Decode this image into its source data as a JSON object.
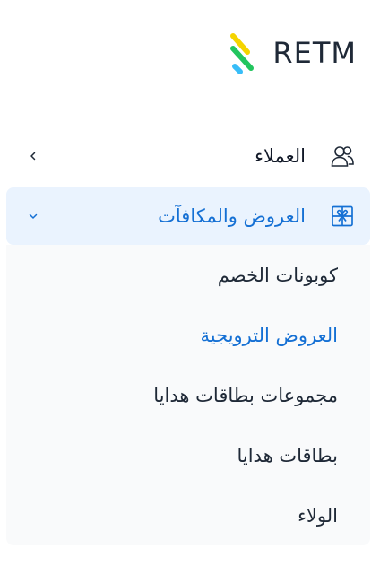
{
  "brand": {
    "name": "RETM",
    "icon": "logo-stripes-icon",
    "colors": [
      "#f5d400",
      "#22c55e",
      "#38bdf8"
    ]
  },
  "sidebar": {
    "items": [
      {
        "label": "العملاء",
        "icon": "users-icon",
        "chevron": "chevron-left-icon",
        "expanded": false
      },
      {
        "label": "العروض والمكافآت",
        "icon": "gift-icon",
        "chevron": "chevron-down-icon",
        "expanded": true,
        "active": true,
        "children": [
          {
            "label": "كوبونات الخصم"
          },
          {
            "label": "العروض الترويجية",
            "current": true
          },
          {
            "label": "مجموعات بطاقات هدايا"
          },
          {
            "label": "بطاقات هدايا"
          },
          {
            "label": "الولاء"
          }
        ]
      }
    ]
  },
  "colors": {
    "accent": "#1570d4",
    "active_bg": "#eaf3fe",
    "submenu_bg": "#f9fafb"
  }
}
